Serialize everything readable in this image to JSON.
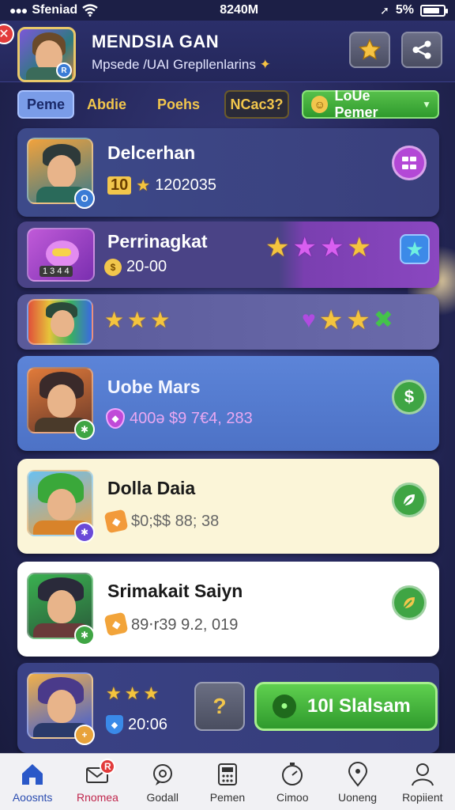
{
  "status_bar": {
    "carrier": "Sfeniad",
    "time": "8240M",
    "battery": "5%",
    "battery_level": 0.85
  },
  "header": {
    "title": "MENDSIA GAN",
    "subtitle": "Mpsede /UAI Grepllenlarins",
    "avatar_badge": "R",
    "close_icon": "close-icon",
    "star_button_icon": "star-icon",
    "share_button_icon": "share-icon"
  },
  "tabs": [
    {
      "label": "Peme",
      "active": true
    },
    {
      "label": "Abdie"
    },
    {
      "label": "Poehs"
    },
    {
      "label": "NCac3?"
    },
    {
      "label": "LoUe Pemer"
    }
  ],
  "list": [
    {
      "name": "Delcerhan",
      "prefix": "10",
      "value": "1202035",
      "badge": "O",
      "action_icon": "grid-icon",
      "action_color": "#b348d6"
    },
    {
      "name": "Perrinagkat",
      "value": "20-00",
      "tag": "1 3 4 4",
      "stars": [
        "gold",
        "pink",
        "pink",
        "gold"
      ],
      "action_icon": "star-box-icon"
    },
    {
      "stars_left": [
        "gold",
        "gold",
        "gold"
      ],
      "stars_right": [
        "purple-heart",
        "gold",
        "gold",
        "green-cross"
      ]
    },
    {
      "name": "Uobe Mars",
      "value": "400ə $9 7€4, 283",
      "badge": "✱",
      "action_icon": "dollar-icon",
      "action_color": "#3fa544"
    },
    {
      "name": "Dolla Daia",
      "value": "$0;$$ 88; 38",
      "badge": "✱",
      "action_icon": "leaf-icon",
      "action_color": "#3fa544"
    },
    {
      "name": "Srimakait Saiyn",
      "value": "89⋅r39 9.2, 019",
      "badge": "✱",
      "action_icon": "leaf-icon",
      "action_color": "#3fa544"
    },
    {
      "value": "20:06",
      "badge": "+",
      "help_label": "?",
      "cta_label": "10I Slalsam"
    }
  ],
  "bottom_nav": [
    {
      "label": "Aoosnts",
      "icon": "home-icon"
    },
    {
      "label": "Rnomea",
      "icon": "mail-icon",
      "notification": "R"
    },
    {
      "label": "Godall",
      "icon": "chat-icon"
    },
    {
      "label": "Pemen",
      "icon": "calculator-icon"
    },
    {
      "label": "Cimoo",
      "icon": "timer-icon"
    },
    {
      "label": "Uoneng",
      "icon": "location-icon"
    },
    {
      "label": "Ropiient",
      "icon": "user-icon"
    }
  ]
}
